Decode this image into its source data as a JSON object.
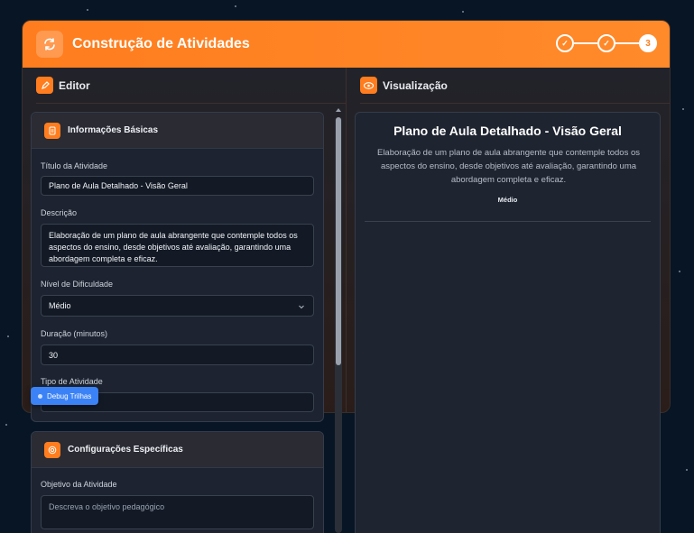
{
  "header": {
    "title": "Construção de Atividades",
    "steps": [
      "✓",
      "✓",
      "3"
    ]
  },
  "columns": {
    "editor_label": "Editor",
    "preview_label": "Visualização"
  },
  "basic_info": {
    "title": "Informações Básicas",
    "fields": {
      "title_label": "Título da Atividade",
      "title_value": "Plano de Aula Detalhado - Visão Geral",
      "desc_label": "Descrição",
      "desc_value": "Elaboração de um plano de aula abrangente que contemple todos os aspectos do ensino, desde objetivos até avaliação, garantindo uma abordagem completa e eficaz.",
      "difficulty_label": "Nível de Dificuldade",
      "difficulty_value": "Médio",
      "duration_label": "Duração (minutos)",
      "duration_value": "30",
      "type_label": "Tipo de Atividade",
      "type_value": ""
    }
  },
  "specific_config": {
    "title": "Configurações Específicas",
    "objective_label": "Objetivo da Atividade",
    "objective_placeholder": "Descreva o objetivo pedagógico"
  },
  "preview": {
    "title": "Plano de Aula Detalhado - Visão Geral",
    "description": "Elaboração de um plano de aula abrangente que contemple todos os aspectos do ensino, desde objetivos até avaliação, garantindo uma abordagem completa e eficaz.",
    "difficulty": "Médio"
  },
  "debug_button": "Debug Trilhas",
  "colors": {
    "accent": "#ff7d1e",
    "debug": "#3b82f6",
    "background": "#071524"
  }
}
